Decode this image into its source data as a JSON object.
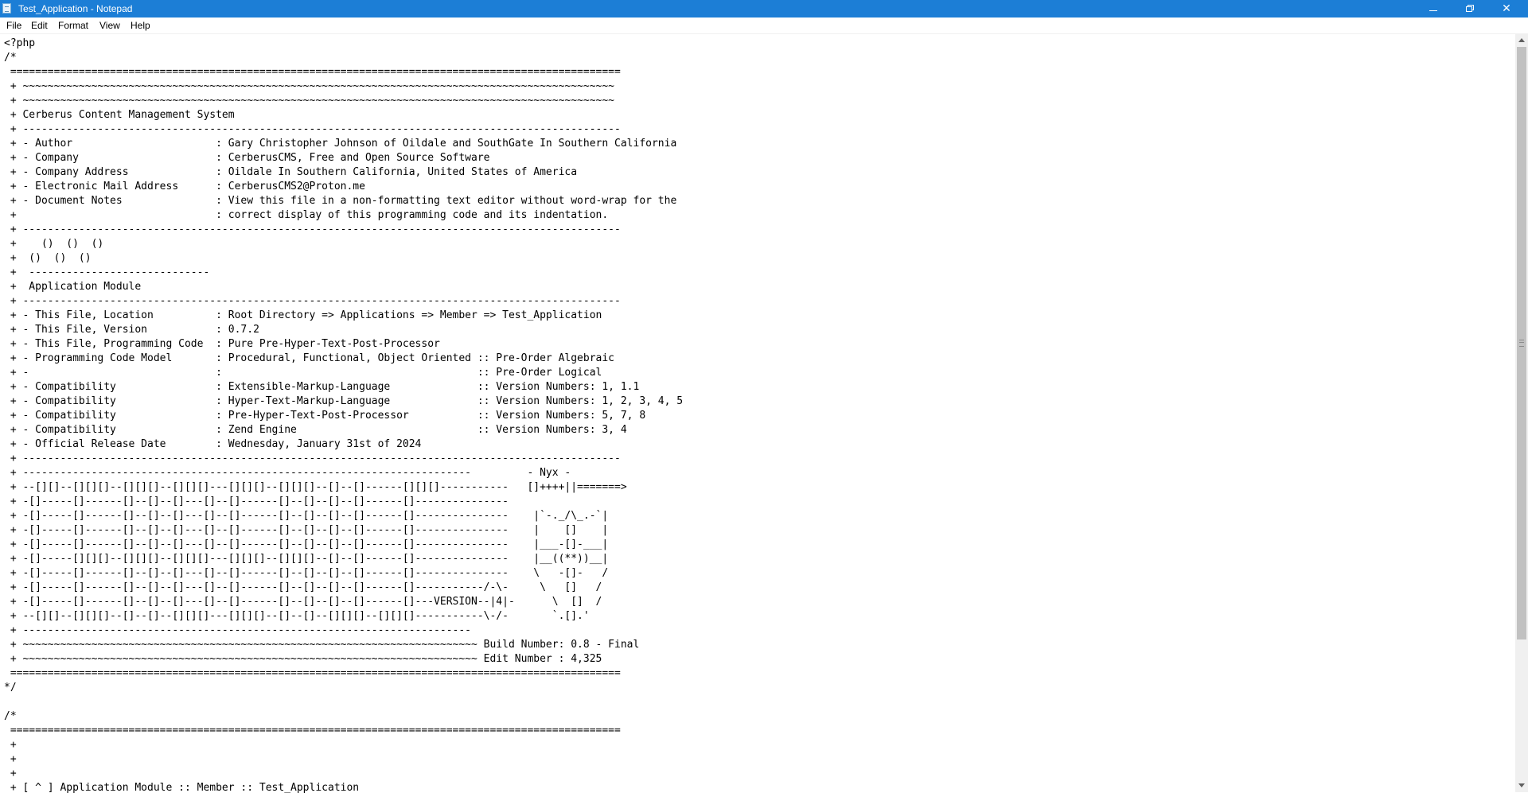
{
  "window": {
    "title": "Test_Application - Notepad",
    "minimize_icon": "minimize-icon",
    "maximize_icon": "restore-icon",
    "close_icon": "close-icon",
    "close_glyph": "✕"
  },
  "colors": {
    "titlebar_bg": "#1c7ed6",
    "editor_bg": "#ffffff",
    "text": "#000000"
  },
  "menu": {
    "items": [
      "File",
      "Edit",
      "Format",
      "View",
      "Help"
    ]
  },
  "editor": {
    "lines": [
      "<?php",
      "/*",
      " ==================================================================================================",
      " + ~~~~~~~~~~~~~~~~~~~~~~~~~~~~~~~~~~~~~~~~~~~~~~~~~~~~~~~~~~~~~~~~~~~~~~~~~~~~~~~~~~~~~~~~~~~~~~~",
      " + ~~~~~~~~~~~~~~~~~~~~~~~~~~~~~~~~~~~~~~~~~~~~~~~~~~~~~~~~~~~~~~~~~~~~~~~~~~~~~~~~~~~~~~~~~~~~~~~",
      " + Cerberus Content Management System",
      " + ------------------------------------------------------------------------------------------------",
      " + - Author                       : Gary Christopher Johnson of Oildale and SouthGate In Southern California",
      " + - Company                      : CerberusCMS, Free and Open Source Software",
      " + - Company Address              : Oildale In Southern California, United States of America",
      " + - Electronic Mail Address      : CerberusCMS2@Proton.me",
      " + - Document Notes               : View this file in a non-formatting text editor without word-wrap for the",
      " +                                : correct display of this programming code and its indentation.",
      " + ------------------------------------------------------------------------------------------------",
      " +    ()  ()  ()",
      " +  ()  ()  ()",
      " +  -----------------------------",
      " +  Application Module",
      " + ------------------------------------------------------------------------------------------------",
      " + - This File, Location          : Root Directory => Applications => Member => Test_Application",
      " + - This File, Version           : 0.7.2",
      " + - This File, Programming Code  : Pure Pre-Hyper-Text-Post-Processor",
      " + - Programming Code Model       : Procedural, Functional, Object Oriented :: Pre-Order Algebraic",
      " + -                              :                                         :: Pre-Order Logical",
      " + - Compatibility                : Extensible-Markup-Language              :: Version Numbers: 1, 1.1",
      " + - Compatibility                : Hyper-Text-Markup-Language              :: Version Numbers: 1, 2, 3, 4, 5",
      " + - Compatibility                : Pre-Hyper-Text-Post-Processor           :: Version Numbers: 5, 7, 8",
      " + - Compatibility                : Zend Engine                             :: Version Numbers: 3, 4",
      " + - Official Release Date        : Wednesday, January 31st of 2024",
      " + ------------------------------------------------------------------------------------------------",
      " + ------------------------------------------------------------------------         - Nyx -",
      " + --[][]--[][][]--[][][]--[][][]---[][][]--[][][]--[]--[]------[][][]-----------   []++++||=======>",
      " + -[]-----[]------[]--[]--[]---[]--[]------[]--[]--[]--[]------[]---------------",
      " + -[]-----[]------[]--[]--[]---[]--[]------[]--[]--[]--[]------[]---------------    |`-._/\\_.-`|",
      " + -[]-----[]------[]--[]--[]---[]--[]------[]--[]--[]--[]------[]---------------    |    []    |",
      " + -[]-----[]------[]--[]--[]---[]--[]------[]--[]--[]--[]------[]---------------    |___-[]-___|",
      " + -[]-----[][][]--[][][]--[][][]---[][][]--[][][]--[]--[]------[]---------------    |__((**))__|",
      " + -[]-----[]------[]--[]--[]---[]--[]------[]--[]--[]--[]------[]---------------    \\   -[]-   /",
      " + -[]-----[]------[]--[]--[]---[]--[]------[]--[]--[]--[]------[]-----------/-\\-     \\   []   /",
      " + -[]-----[]------[]--[]--[]---[]--[]------[]--[]--[]--[]------[]---VERSION--|4|-      \\  []  /",
      " + --[][]--[][][]--[]--[]--[][][]---[][][]--[]--[]--[][][]--[][][]-----------\\-/-       `.[].'",
      " + ------------------------------------------------------------------------",
      " + ~~~~~~~~~~~~~~~~~~~~~~~~~~~~~~~~~~~~~~~~~~~~~~~~~~~~~~~~~~~~~~~~~~~~~~~~~ Build Number: 0.8 - Final",
      " + ~~~~~~~~~~~~~~~~~~~~~~~~~~~~~~~~~~~~~~~~~~~~~~~~~~~~~~~~~~~~~~~~~~~~~~~~~ Edit Number : 4,325",
      " ==================================================================================================",
      "*/",
      "",
      "/*",
      " ==================================================================================================",
      " +",
      " +",
      " +",
      " + [ ^ ] Application Module :: Member :: Test_Application"
    ]
  },
  "scrollbar": {
    "position": 0
  }
}
